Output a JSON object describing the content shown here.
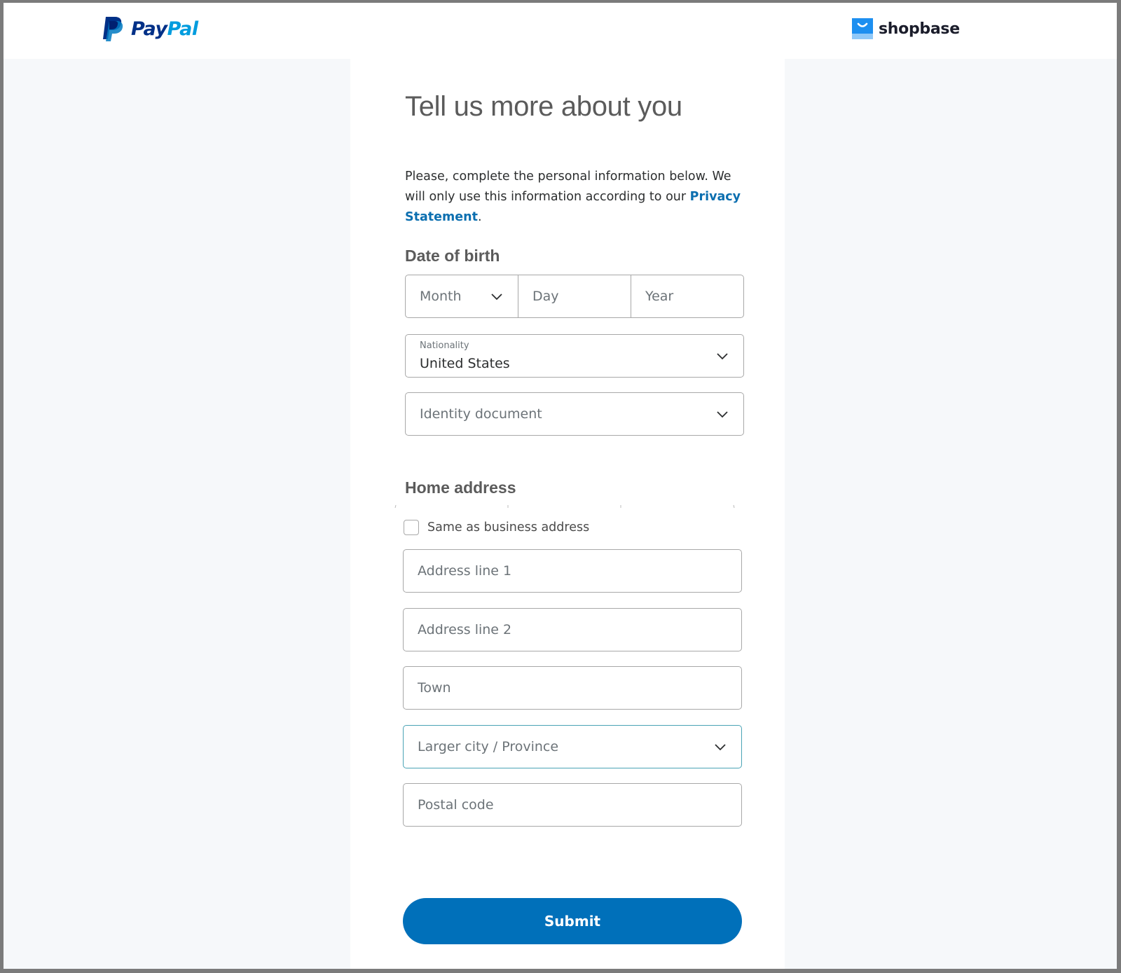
{
  "header": {
    "paypal_logo": {
      "part1": "Pay",
      "part2": "Pal",
      "icon": "paypal-p-icon"
    },
    "shopbase_logo": {
      "text": "shopbase",
      "icon": "shopping-bag-icon"
    }
  },
  "form": {
    "title": "Tell us more about you",
    "intro_text": "Please, complete the personal information below. We will only use this information according to our ",
    "intro_link": "Privacy Statement",
    "intro_end": ".",
    "dob_heading": "Date of birth",
    "dob": {
      "month_placeholder": "Month",
      "day_placeholder": "Day",
      "year_placeholder": "Year"
    },
    "nationality": {
      "label": "Nationality",
      "value": "United States"
    },
    "identity_document": {
      "placeholder": "Identity document"
    },
    "home_address_heading": "Home address",
    "same_as_business": {
      "label": "Same as business address",
      "checked": false
    },
    "address_line1": {
      "placeholder": "Address line 1"
    },
    "address_line2": {
      "placeholder": "Address line 2"
    },
    "town": {
      "placeholder": "Town"
    },
    "province": {
      "placeholder": "Larger city / Province"
    },
    "postal_code": {
      "placeholder": "Postal code"
    },
    "submit_label": "Submit"
  },
  "colors": {
    "primary_button": "#0070ba",
    "link": "#0c6fb0",
    "paypal_dark": "#003087",
    "paypal_light": "#009cde",
    "shopbase_blue": "#1d8ff0",
    "focus_border": "#4aa3b5"
  }
}
